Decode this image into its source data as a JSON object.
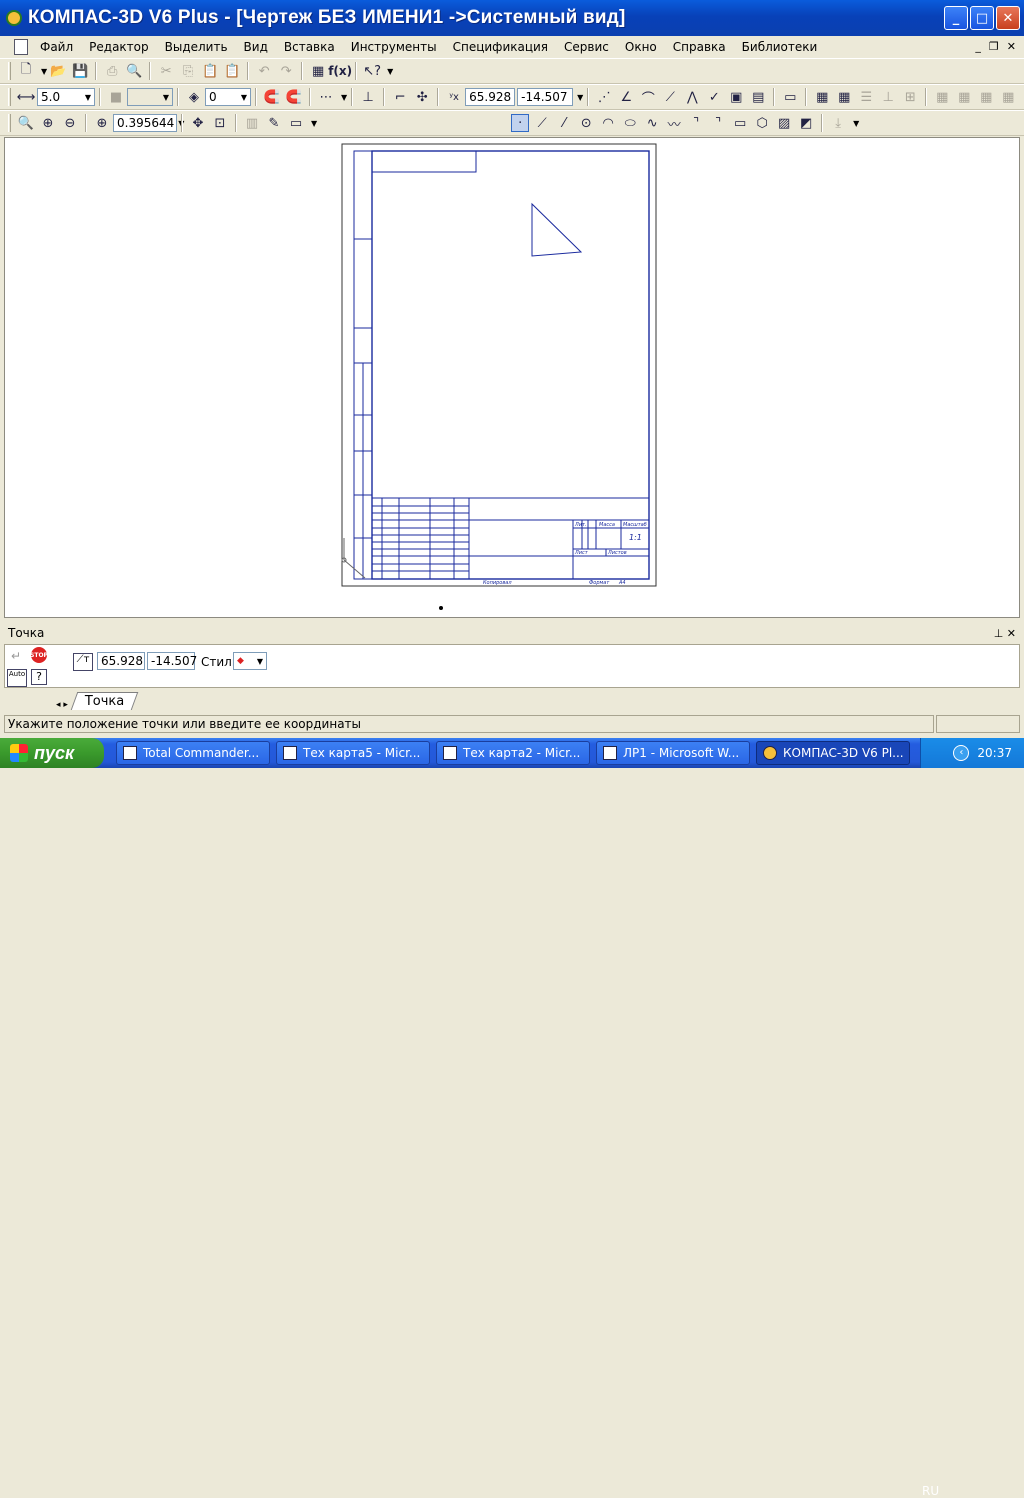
{
  "window": {
    "title": "КОМПАС-3D V6 Plus - [Чертеж БЕЗ ИМЕНИ1 ->Системный вид]"
  },
  "menu": [
    "Файл",
    "Редактор",
    "Выделить",
    "Вид",
    "Вставка",
    "Инструменты",
    "Спецификация",
    "Сервис",
    "Окно",
    "Справка",
    "Библиотеки"
  ],
  "toolbar": {
    "step": "5.0",
    "layer": "0",
    "coord_x": "65.928",
    "coord_y": "-14.507",
    "zoom": "0.395644"
  },
  "panel": {
    "title": "Точка",
    "x": "65.928",
    "y": "-14.507",
    "style_label": "Стиль",
    "tab": "Точка"
  },
  "status": {
    "message": "Укажите положение точки или введите ее координаты"
  },
  "taskbar": {
    "start": "пуск",
    "tasks": [
      "Total Commander...",
      "Тех карта5 - Micr...",
      "Тех карта2 - Micr...",
      "ЛР1 - Microsoft W...",
      "КОМПАС-3D V6 Pl..."
    ],
    "lang": "RU",
    "time": "20:37"
  },
  "drawing": {
    "titleblock_sheet": "1:1",
    "format_label": "Формат",
    "format_value": "A4",
    "copied_label": "Копировал",
    "lit_label": "Лит.",
    "mass_label": "Масса",
    "scale_label": "Масштаб",
    "sheet_label": "Лист",
    "sheets_label": "Листов"
  },
  "colors": {
    "drawing_line": "#1a2a9e",
    "accent": "#0a5cdc"
  }
}
